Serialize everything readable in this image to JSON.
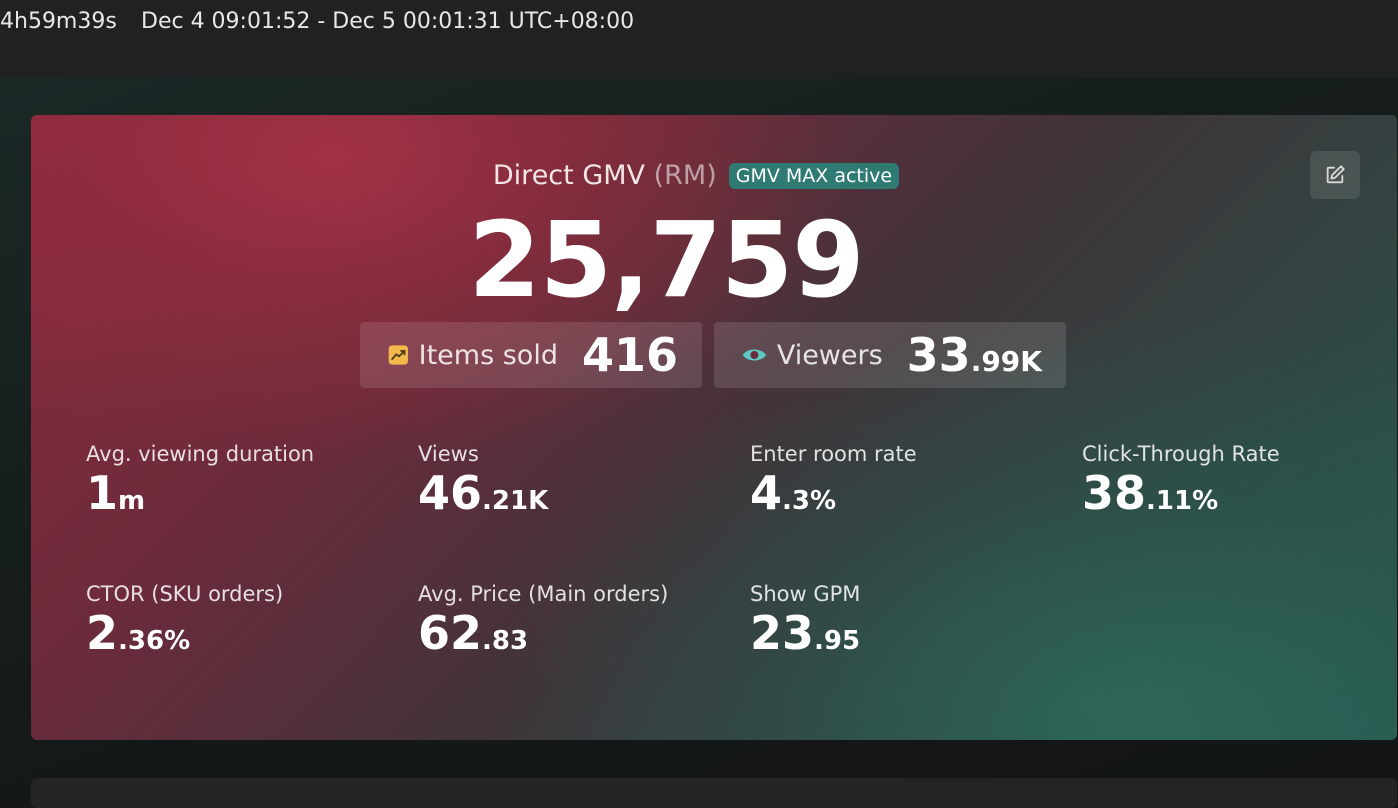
{
  "header": {
    "duration": "4h59m39s",
    "range": "Dec 4 09:01:52 - Dec 5 00:01:31 UTC+08:00"
  },
  "card": {
    "title": "Direct GMV",
    "unit": "(RM)",
    "badge": "GMV MAX active",
    "gmv_value": "25,759",
    "edit_icon": "edit-icon",
    "items_sold": {
      "icon": "trending-up-icon",
      "label": "Items sold",
      "value": "416"
    },
    "viewers": {
      "icon": "eye-icon",
      "label": "Viewers",
      "value_main": "33",
      "value_suffix": ".99K"
    }
  },
  "metrics": [
    {
      "label": "Avg. viewing duration",
      "main": "1",
      "suffix": "m"
    },
    {
      "label": "Views",
      "main": "46",
      "suffix": ".21K"
    },
    {
      "label": "Enter room rate",
      "main": "4",
      "suffix": ".3%"
    },
    {
      "label": "Click-Through Rate",
      "main": "38",
      "suffix": ".11%"
    },
    {
      "label": "CTOR (SKU orders)",
      "main": "2",
      "suffix": ".36%"
    },
    {
      "label": "Avg. Price (Main orders)",
      "main": "62",
      "suffix": ".83"
    },
    {
      "label": "Show GPM",
      "main": "23",
      "suffix": ".95"
    }
  ],
  "colors": {
    "badge": "#2f7a72",
    "items_icon": "#f2b84b",
    "eye_icon": "#5ec7c2"
  }
}
